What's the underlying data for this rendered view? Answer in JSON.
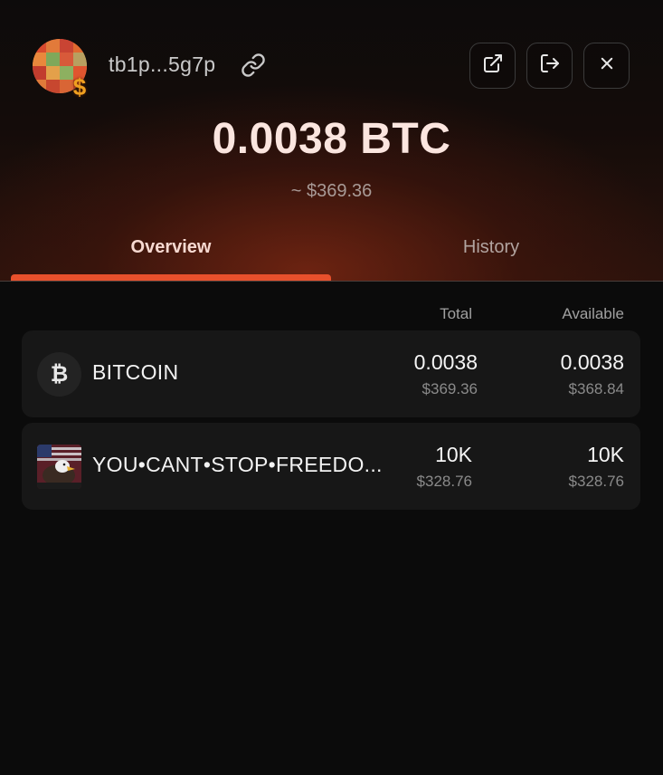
{
  "wallet": {
    "address_short": "tb1p...5g7p",
    "balance_btc": "0.0038 BTC",
    "balance_fiat": "~ $369.36"
  },
  "header_actions": {
    "open_icon": "external-link-icon",
    "logout_icon": "logout-icon",
    "close_icon": "close-icon",
    "copy_icon": "link-icon"
  },
  "tabs": [
    {
      "label": "Overview",
      "active": true
    },
    {
      "label": "History",
      "active": false
    }
  ],
  "table": {
    "columns": [
      "Total",
      "Available"
    ],
    "rows": [
      {
        "icon": "bitcoin-icon",
        "icon_glyph": "₿",
        "name": "BITCOIN",
        "total": "0.0038",
        "total_fiat": "$369.36",
        "available": "0.0038",
        "available_fiat": "$368.84"
      },
      {
        "icon": "rune-eagle-flag-icon",
        "name": "YOU•CANT•STOP•FREEDO...",
        "total": "10K",
        "total_fiat": "$328.76",
        "available": "10K",
        "available_fiat": "$328.76"
      }
    ]
  },
  "colors": {
    "accent": "#e8502c",
    "background": "#0b0b0b",
    "row_background": "#171717"
  }
}
